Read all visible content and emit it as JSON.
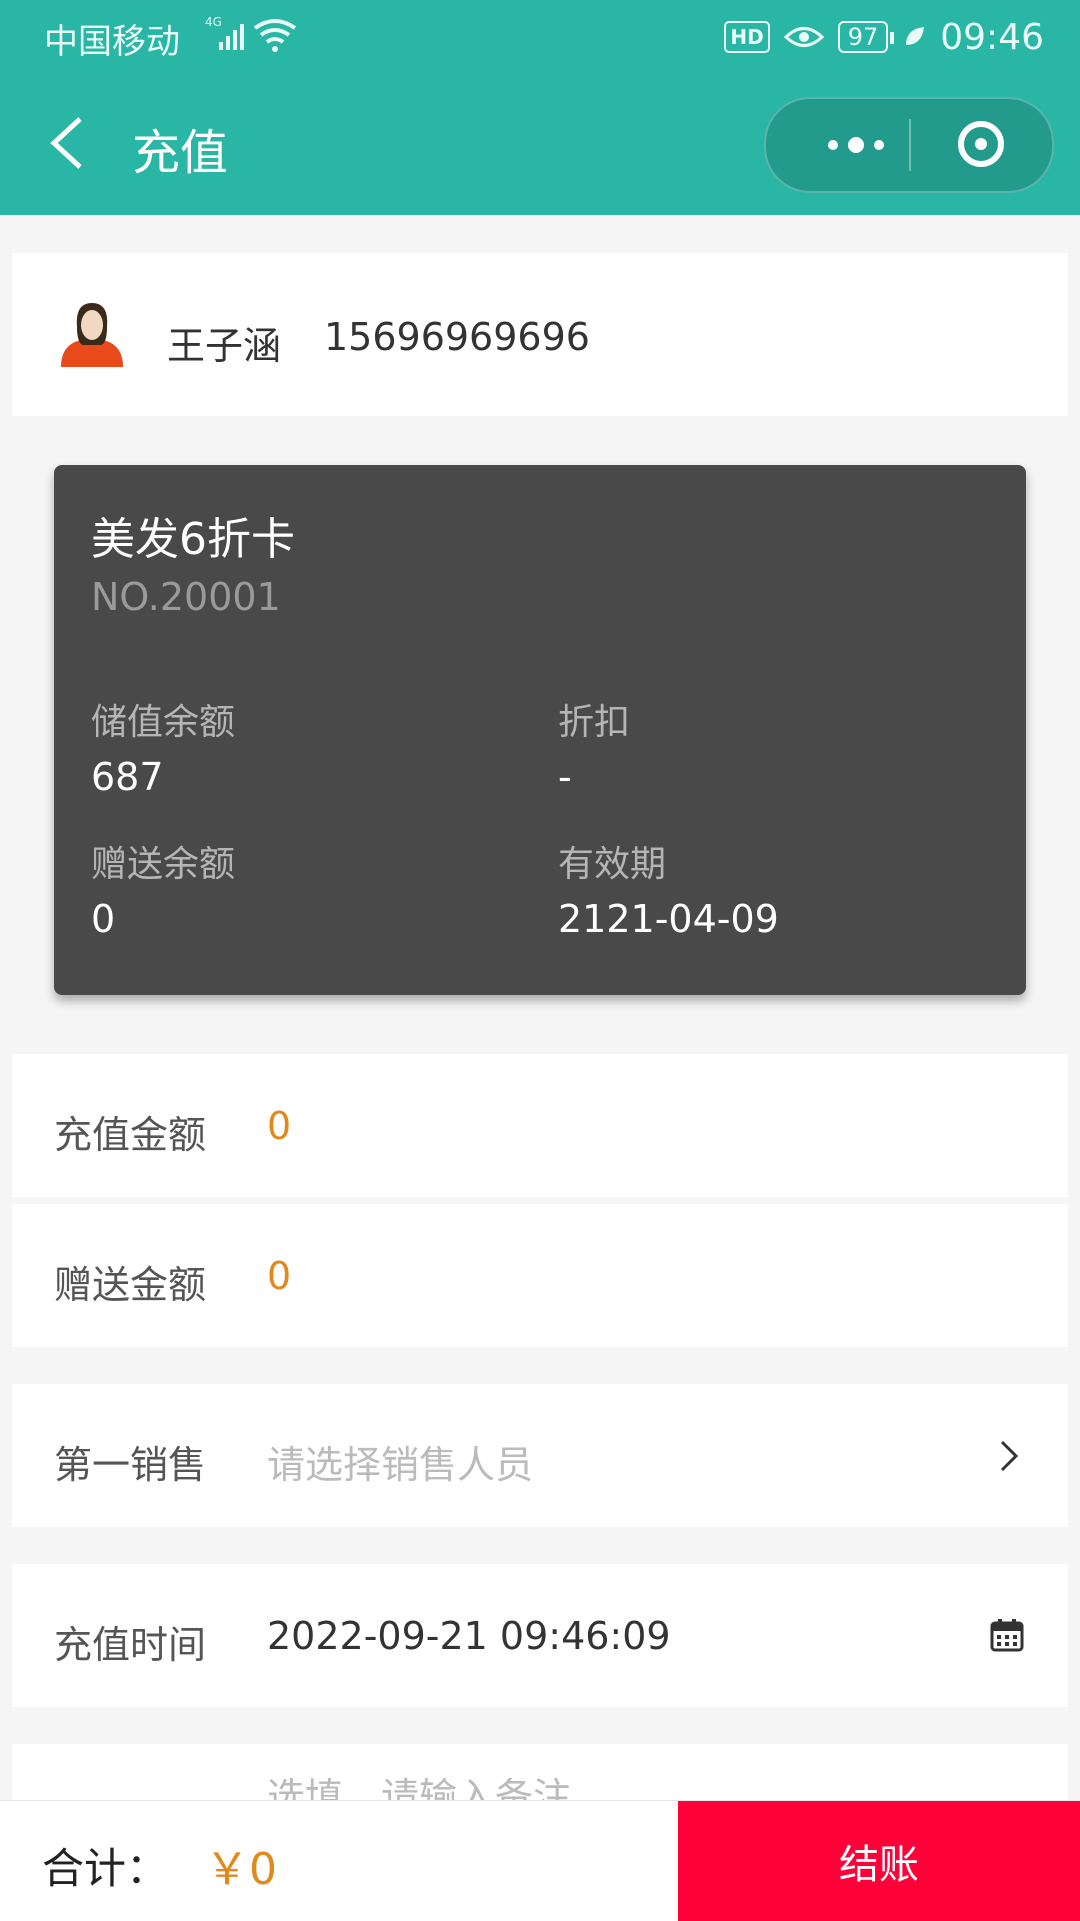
{
  "status_bar": {
    "carrier": "中国移动",
    "network": "4G",
    "hd": "HD",
    "battery": "97",
    "time": "09:46"
  },
  "nav": {
    "title": "充值"
  },
  "customer": {
    "name": "王子涵",
    "phone": "15696969696"
  },
  "card": {
    "title": "美发6折卡",
    "number": "NO.20001",
    "stored_balance_label": "储值余额",
    "stored_balance": "687",
    "discount_label": "折扣",
    "discount": "-",
    "gift_balance_label": "赠送余额",
    "gift_balance": "0",
    "validity_label": "有效期",
    "validity": "2121-04-09"
  },
  "form": {
    "recharge_amount_label": "充值金额",
    "recharge_amount": "0",
    "gift_amount_label": "赠送金额",
    "gift_amount": "0",
    "first_sales_label": "第一销售",
    "first_sales_placeholder": "请选择销售人员",
    "recharge_time_label": "充值时间",
    "recharge_time": "2022-09-21 09:46:09",
    "remark_placeholder": "选填，请输入备注"
  },
  "footer": {
    "total_label": "合计：",
    "total_value": "￥0",
    "checkout_label": "结账"
  },
  "colors": {
    "header": "#29b6a5",
    "accent_orange": "#e08a1e",
    "checkout": "#ff0038",
    "card_bg": "#4a4949"
  }
}
